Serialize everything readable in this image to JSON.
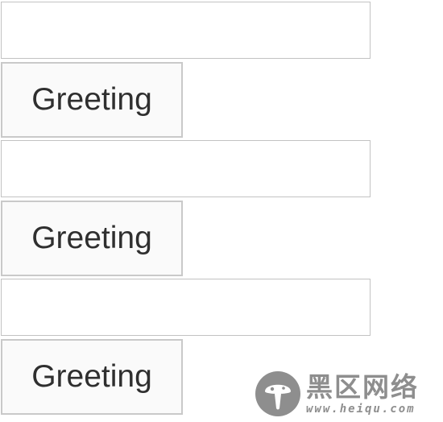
{
  "form": {
    "rows": [
      {
        "input_value": "",
        "button_label": "Greeting"
      },
      {
        "input_value": "",
        "button_label": "Greeting"
      },
      {
        "input_value": "",
        "button_label": "Greeting"
      }
    ]
  },
  "watermark": {
    "site_name": "黑区网络",
    "url": "www.heiqu.com",
    "logo_icon": "mushroom-logo-icon"
  },
  "colors": {
    "border_input": "#c2c2c2",
    "border_button": "#c9c9c9",
    "button_bg": "#fafafa",
    "text": "#2f2f2f",
    "watermark": "#8e8e8e"
  }
}
